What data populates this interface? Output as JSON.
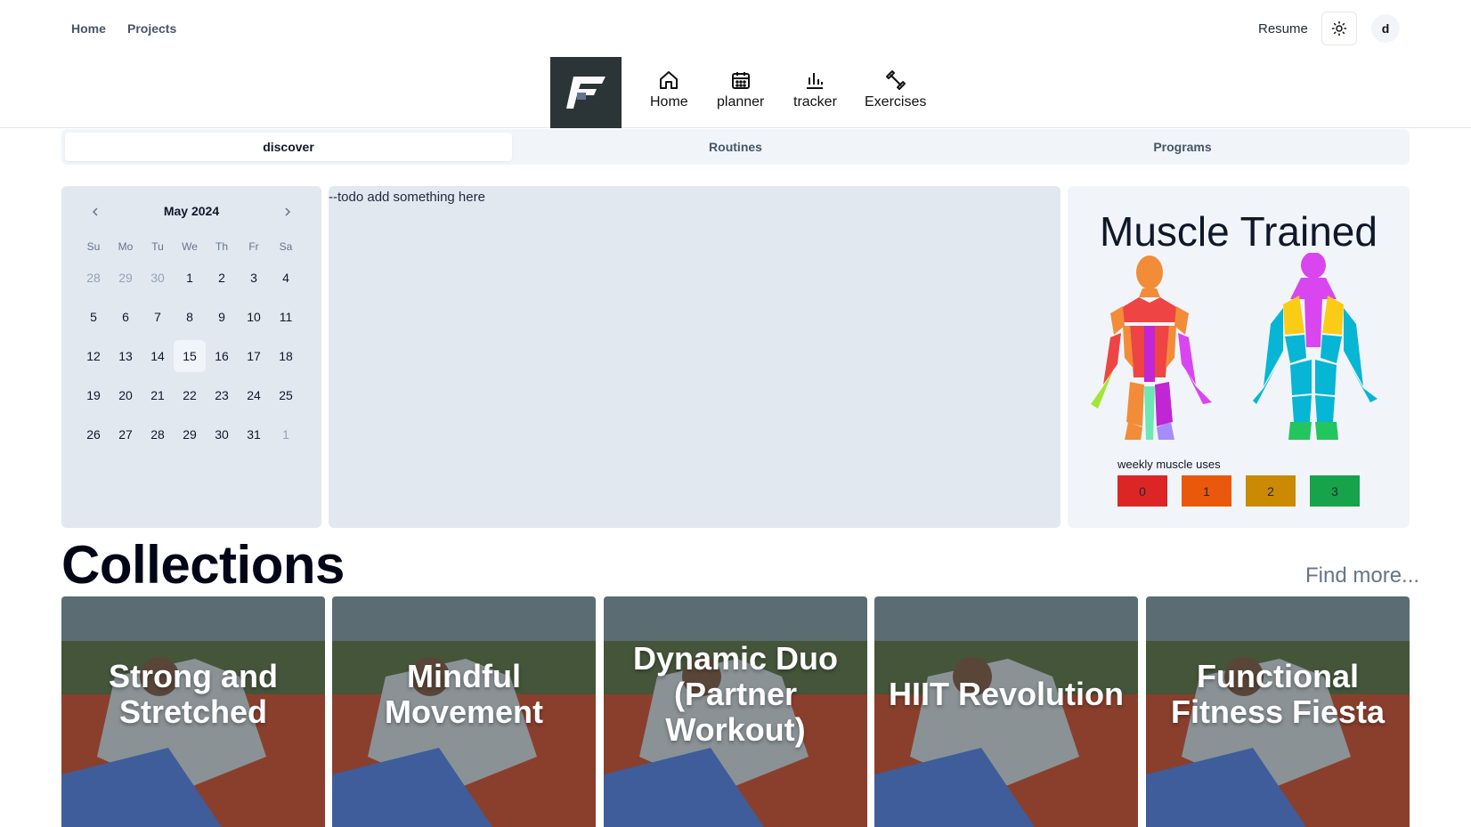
{
  "topbar": {
    "links": [
      "Home",
      "Projects"
    ],
    "resume_label": "Resume",
    "theme_icon": "sun-icon",
    "avatar_initial": "d"
  },
  "nav": {
    "logo_letter": "F",
    "items": [
      {
        "label": "Home",
        "icon": "home-icon"
      },
      {
        "label": "planner",
        "icon": "calendar-icon"
      },
      {
        "label": "tracker",
        "icon": "bar-chart-icon"
      },
      {
        "label": "Exercises",
        "icon": "dumbbell-icon"
      }
    ]
  },
  "tabs": [
    {
      "label": "discover",
      "active": true
    },
    {
      "label": "Routines",
      "active": false
    },
    {
      "label": "Programs",
      "active": false
    }
  ],
  "calendar": {
    "month_label": "May 2024",
    "weekdays": [
      "Su",
      "Mo",
      "Tu",
      "We",
      "Th",
      "Fr",
      "Sa"
    ],
    "weeks": [
      [
        "28",
        "29",
        "30",
        "1",
        "2",
        "3",
        "4"
      ],
      [
        "5",
        "6",
        "7",
        "8",
        "9",
        "10",
        "11"
      ],
      [
        "12",
        "13",
        "14",
        "15",
        "16",
        "17",
        "18"
      ],
      [
        "19",
        "20",
        "21",
        "22",
        "23",
        "24",
        "25"
      ],
      [
        "26",
        "27",
        "28",
        "29",
        "30",
        "31",
        "1"
      ]
    ],
    "today": "15"
  },
  "todo": {
    "text": "--todo add something here"
  },
  "muscle": {
    "title": "Muscle Trained",
    "legend_label": "weekly muscle uses",
    "legend": [
      {
        "value": "0",
        "color": "#dc2626"
      },
      {
        "value": "1",
        "color": "#ea580c"
      },
      {
        "value": "2",
        "color": "#ca8a04"
      },
      {
        "value": "3",
        "color": "#16a34a"
      }
    ]
  },
  "collections": {
    "title": "Collections",
    "find_more": "Find more...",
    "cards": [
      "Strong and Stretched",
      "Mindful Movement",
      "Dynamic Duo (Partner Workout)",
      "HIIT Revolution",
      "Functional Fitness Fiesta"
    ]
  }
}
